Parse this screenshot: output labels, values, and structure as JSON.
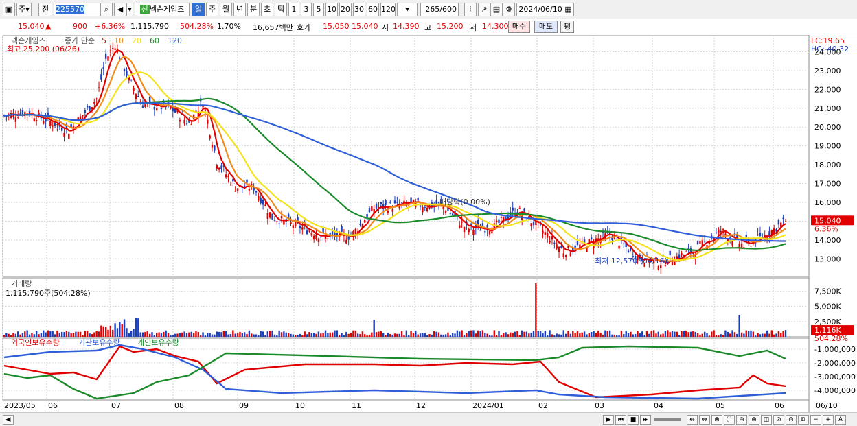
{
  "toolbar": {
    "market_type": "주",
    "prev_label": "전",
    "stock_code": "225570",
    "stock_badge": "신",
    "stock_name": "넥슨게임즈",
    "periods": [
      "일",
      "주",
      "월",
      "년",
      "분",
      "초",
      "틱"
    ],
    "active_period": "일",
    "intervals": [
      "1",
      "3",
      "5",
      "10",
      "20",
      "30",
      "60",
      "120"
    ],
    "count": "265",
    "count_total": "/600",
    "date": "2024/06/10"
  },
  "quote": {
    "price": "15,040",
    "change_arrow": "▲",
    "change": "900",
    "change_pct": "+6.36%",
    "volume": "1,115,790",
    "volume_ratio": "504.28%",
    "turnover": "1.70%",
    "amount": "16,657백만",
    "bid_label": "호가",
    "bid1": "15,050",
    "bid2": "15,040",
    "open_label": "시",
    "open": "14,390",
    "high_label": "고",
    "high": "15,200",
    "low_label": "저",
    "low": "14,300",
    "buy_btn": "매수",
    "sell_btn": "매도",
    "eval_btn": "평"
  },
  "price_panel": {
    "stock_name": "넥슨게임즈",
    "ma_label": "종가 단순",
    "ma_periods": [
      "5",
      "10",
      "20",
      "60",
      "120"
    ],
    "ma_colors": [
      "#e00000",
      "#f08c1c",
      "#f4e21a",
      "#1a8a2a",
      "#2f5fd8"
    ],
    "high_marker": "최고 25,200 (06/26)",
    "low_marker": "최저 12,570 (04/16)",
    "dividend_marker": "배당락(0.00%)",
    "lc": "LC:19.65",
    "hc": "HC:-40.32",
    "current_price": "15,040",
    "current_pct": "6.36%",
    "y_ticks": [
      "24,000",
      "23,000",
      "22,000",
      "21,000",
      "20,000",
      "19,000",
      "18,000",
      "17,000",
      "16,000",
      "15,000",
      "14,000",
      "13,000"
    ]
  },
  "volume_panel": {
    "title": "거래량",
    "value": "1,115,790주(504.28%)",
    "y_ticks": [
      "7,500K",
      "5,000K",
      "2,500K"
    ],
    "current": "1,116K",
    "current_pct": "504.28%"
  },
  "holding_panel": {
    "series": [
      "외국인보유수량",
      "기관보유수량",
      "개인보유수량"
    ],
    "series_colors": [
      "#e00000",
      "#2f5fd8",
      "#1a8a2a"
    ],
    "y_ticks": [
      "-1,000,000",
      "-2,000,000",
      "-3,000,000",
      "-4,000,000"
    ]
  },
  "x_axis": {
    "labels": [
      "2023/05",
      "06",
      "07",
      "08",
      "09",
      "10",
      "11",
      "12",
      "2024/01",
      "02",
      "03",
      "04",
      "05",
      "06"
    ],
    "right_label": "06/10"
  },
  "chart_data": {
    "type": "line",
    "x_labels": [
      "2023/05",
      "06",
      "07",
      "08",
      "09",
      "10",
      "11",
      "12",
      "2024/01",
      "02",
      "03",
      "04",
      "05",
      "06"
    ],
    "ma_lines": [
      "5",
      "10",
      "20",
      "60",
      "120"
    ],
    "y_range": [
      12500,
      24600
    ],
    "price_series_monthly": [
      {
        "x": "2023/05",
        "close": 20500
      },
      {
        "x": "06",
        "close": 21000
      },
      {
        "x": "07",
        "close": 21000
      },
      {
        "x": "08",
        "close": 17000
      },
      {
        "x": "09",
        "close": 15200
      },
      {
        "x": "10",
        "close": 14200
      },
      {
        "x": "11",
        "close": 16000
      },
      {
        "x": "12",
        "close": 15800
      },
      {
        "x": "2024/01",
        "close": 14800
      },
      {
        "x": "02",
        "close": 15500
      },
      {
        "x": "03",
        "close": 13700
      },
      {
        "x": "04",
        "close": 12900
      },
      {
        "x": "05",
        "close": 14300
      },
      {
        "x": "06",
        "close": 15040
      }
    ]
  }
}
